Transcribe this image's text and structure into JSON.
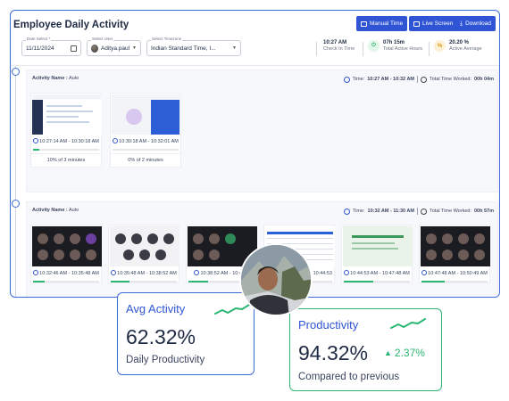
{
  "header": {
    "title": "Employee Daily Activity",
    "buttons": [
      {
        "label": "Manual Time"
      },
      {
        "label": "Live Screen"
      },
      {
        "label": "Download"
      }
    ]
  },
  "filters": {
    "date": {
      "label": "Date Select *",
      "value": "11/11/2024"
    },
    "user": {
      "label": "Select User",
      "value": "Aditya.paul"
    },
    "timezone": {
      "label": "Select Timezone",
      "value": "Indian Standard Time, I..."
    }
  },
  "stats": [
    {
      "value": "10:27 AM",
      "label": "Check In Time"
    },
    {
      "value": "07h 15m",
      "label": "Total Active Hours"
    },
    {
      "value": "20.20 %",
      "label": "Active Average"
    }
  ],
  "activities": [
    {
      "name_label": "Activity Name :",
      "name_value": "Auto",
      "time_label": "Time:",
      "time_value": "10:27 AM - 10:32 AM",
      "worked_label": "Total Time Worked:",
      "worked_value": "00h 04m",
      "shots": [
        {
          "range": "10:27:14 AM - 10:30:18 AM",
          "progress_pct": 10,
          "caption": "10% of 3 minutes"
        },
        {
          "range": "10:30:18 AM - 10:32:01 AM",
          "progress_pct": 0,
          "caption": "0% of 2 minutes"
        }
      ]
    },
    {
      "name_label": "Activity Name :",
      "name_value": "Auto",
      "time_label": "Time:",
      "time_value": "10:32 AM - 11:30 AM",
      "worked_label": "Total Time Worked:",
      "worked_value": "00h 57m",
      "shots": [
        {
          "range": "10:32:46 AM - 10:35:48 AM",
          "progress_pct": 18
        },
        {
          "range": "10:35:48 AM - 10:38:52 AM",
          "progress_pct": 28
        },
        {
          "range": "10:38:52 AM - 10:41:5",
          "progress_pct": 30
        },
        {
          "range": "10:44:53",
          "progress_pct": 22
        },
        {
          "range": "10:44:53 AM - 10:47:48 AM",
          "progress_pct": 45
        },
        {
          "range": "10:47:48 AM - 10:50:49 AM",
          "progress_pct": 35
        }
      ]
    }
  ],
  "overlays": {
    "avg_activity": {
      "title": "Avg Activity",
      "value": "62.32%",
      "subtitle": "Daily Productivity"
    },
    "productivity": {
      "title": "Productivity",
      "value": "94.32%",
      "change": "2.37%",
      "subtitle": "Compared to previous"
    }
  },
  "colors": {
    "accent": "#2f55d4",
    "green": "#2bb673",
    "text": "#1f2a44"
  }
}
